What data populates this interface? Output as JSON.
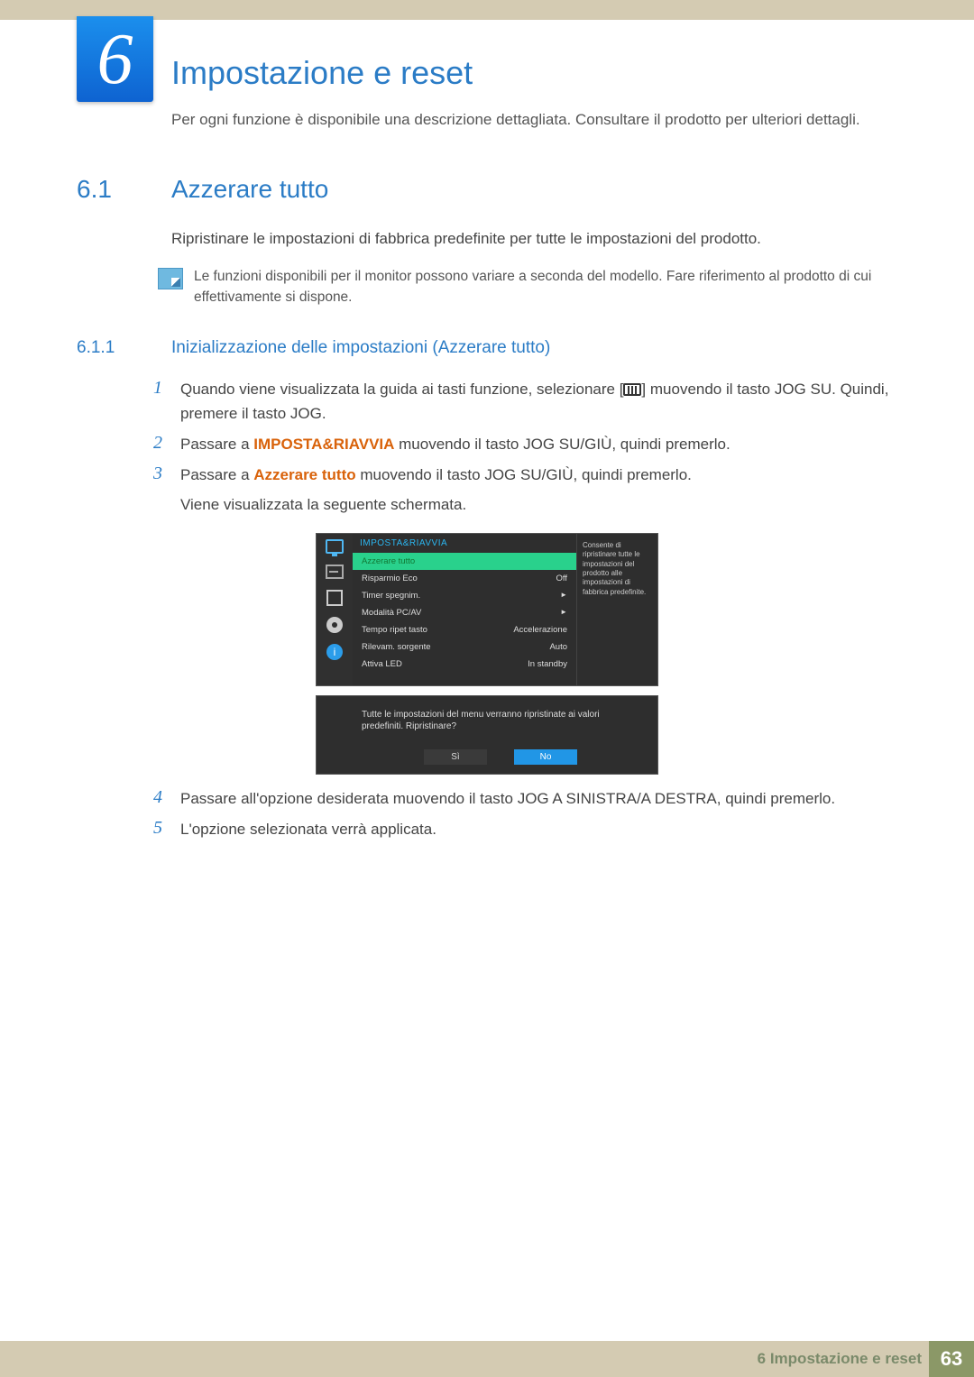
{
  "chapter_number": "6",
  "title": "Impostazione e reset",
  "intro": "Per ogni funzione è disponibile una descrizione dettagliata. Consultare il prodotto per ulteriori dettagli.",
  "section": {
    "num": "6.1",
    "title": "Azzerare tutto"
  },
  "section_intro": "Ripristinare le impostazioni di fabbrica predefinite per tutte le impostazioni del prodotto.",
  "note": "Le funzioni disponibili per il monitor possono variare a seconda del modello. Fare riferimento al prodotto di cui effettivamente si dispone.",
  "subsection": {
    "num": "6.1.1",
    "title": "Inizializzazione delle impostazioni (Azzerare tutto)"
  },
  "steps": {
    "s1a": "Quando viene visualizzata la guida ai tasti funzione, selezionare [",
    "s1b": "] muovendo il tasto JOG SU. Quindi, premere il tasto JOG.",
    "s2a": "Passare a ",
    "s2_emph": "IMPOSTA&RIAVVIA",
    "s2b": " muovendo il tasto JOG SU/GIÙ, quindi premerlo.",
    "s3a": "Passare a ",
    "s3_emph": "Azzerare tutto",
    "s3b": " muovendo il tasto JOG SU/GIÙ, quindi premerlo.",
    "s3c": "Viene visualizzata la seguente schermata.",
    "s4": "Passare all'opzione desiderata muovendo il tasto JOG A SINISTRA/A DESTRA, quindi premerlo.",
    "s5": "L'opzione selezionata verrà applicata."
  },
  "step_nums": {
    "n1": "1",
    "n2": "2",
    "n3": "3",
    "n4": "4",
    "n5": "5"
  },
  "osd": {
    "header": "IMPOSTA&RIAVVIA",
    "rows": [
      {
        "label": "Azzerare tutto",
        "value": ""
      },
      {
        "label": "Risparmio Eco",
        "value": "Off"
      },
      {
        "label": "Timer spegnim.",
        "value": "►"
      },
      {
        "label": "Modalità PC/AV",
        "value": "►"
      },
      {
        "label": "Tempo ripet tasto",
        "value": "Accelerazione"
      },
      {
        "label": "Rilevam. sorgente",
        "value": "Auto"
      },
      {
        "label": "Attiva LED",
        "value": "In standby"
      }
    ],
    "desc": "Consente di ripristinare tutte le impostazioni del prodotto alle impostazioni di fabbrica predefinite.",
    "confirm_msg": "Tutte le impostazioni del menu verranno ripristinate ai valori predefiniti. Ripristinare?",
    "yes": "Sì",
    "no": "No"
  },
  "footer": {
    "chapter_label": "6 Impostazione e reset",
    "page": "63"
  }
}
